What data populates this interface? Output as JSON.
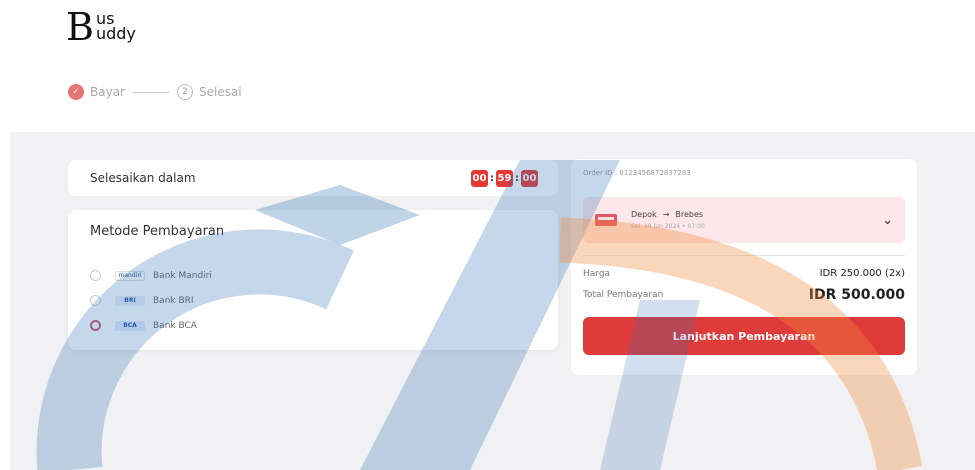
{
  "brand": {
    "big_letter": "B",
    "top": "us",
    "bottom": "uddy"
  },
  "steps": [
    {
      "label": "Bayar",
      "marker": "✓",
      "state": "done"
    },
    {
      "label": "Selesai",
      "marker": "2",
      "state": "todo"
    }
  ],
  "timer": {
    "label": "Selesaikan dalam",
    "hours": "00",
    "minutes": "59",
    "seconds": "00"
  },
  "payment_methods": {
    "title": "Metode Pembayaran",
    "options": [
      {
        "bank": "Bank Mandiri",
        "logo_text": "mandiri",
        "selected": false
      },
      {
        "bank": "Bank BRI",
        "logo_text": "BRI",
        "selected": false
      },
      {
        "bank": "Bank BCA",
        "logo_text": "BCA",
        "selected": true
      }
    ]
  },
  "summary": {
    "order_id": "Order ID : 0123456872837283",
    "route": {
      "from": "Depok",
      "arrow": "→",
      "to": "Brebes",
      "date": "Sel, 18 Jun 2024",
      "dot": "•",
      "time": "07:00"
    },
    "price_label": "Harga",
    "price_value": "IDR 250.000 (2x)",
    "total_label": "Total Pembayaran",
    "total_value": "IDR 500.000",
    "cta": "Lanjutkan Pembayaran"
  },
  "colors": {
    "accent": "#e03b3b",
    "route_bg": "#fde7ea",
    "band": "#f1f1f3"
  }
}
